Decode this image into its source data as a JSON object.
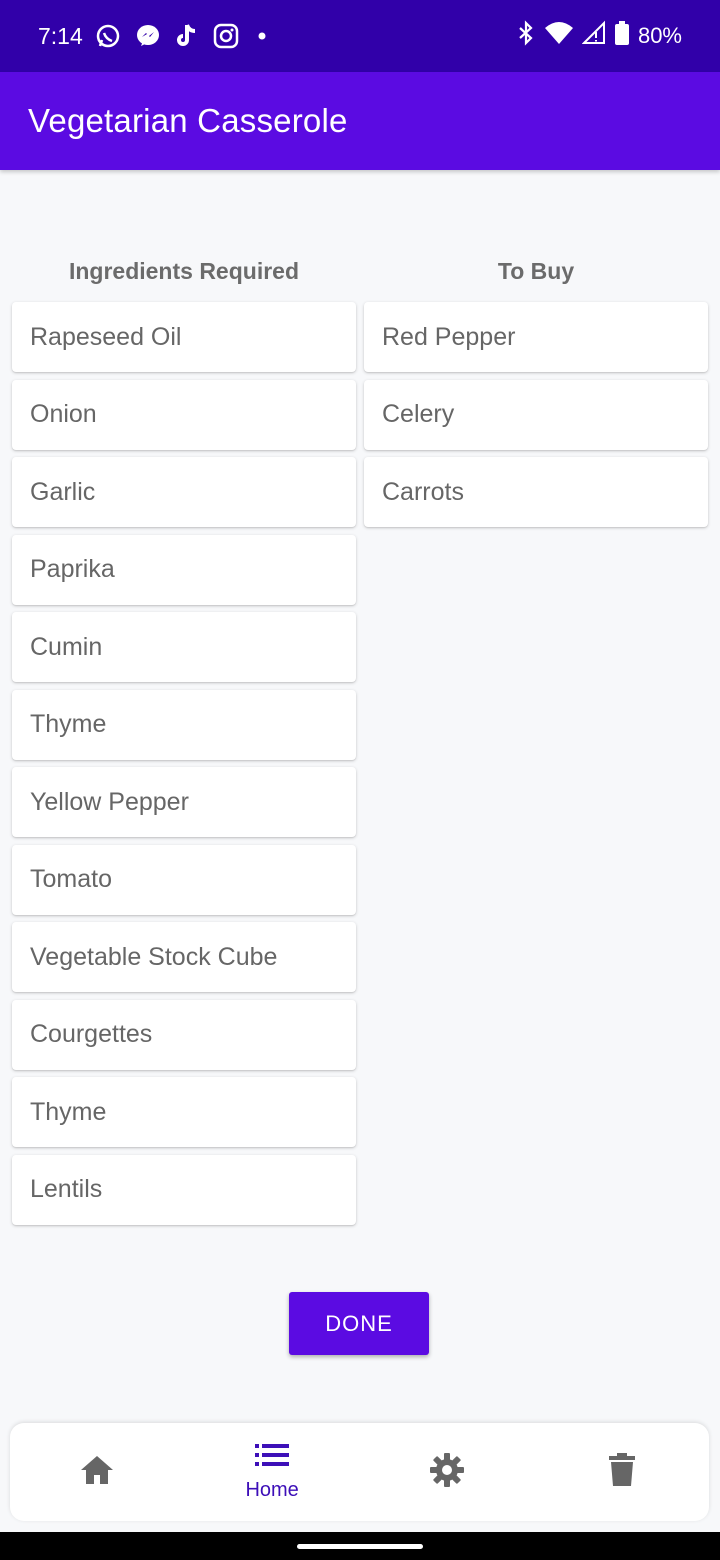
{
  "status_bar": {
    "time": "7:14",
    "battery": "80%",
    "icons": [
      "whatsapp-icon",
      "messenger-icon",
      "tiktok-icon",
      "instagram-icon",
      "dot-icon",
      "bluetooth-icon",
      "wifi-icon",
      "signal-icon",
      "battery-icon"
    ]
  },
  "app_bar": {
    "title": "Vegetarian Casserole"
  },
  "columns": {
    "required_header": "Ingredients Required",
    "to_buy_header": "To Buy"
  },
  "required": [
    "Rapeseed Oil",
    "Onion",
    "Garlic",
    "Paprika",
    "Cumin",
    "Thyme",
    "Yellow Pepper",
    "Tomato",
    "Vegetable Stock Cube",
    "Courgettes",
    "Thyme",
    "Lentils"
  ],
  "to_buy": [
    "Red Pepper",
    "Celery",
    "Carrots"
  ],
  "done_label": "DONE",
  "bottom_nav": {
    "items": [
      {
        "icon": "home-icon",
        "label": ""
      },
      {
        "icon": "list-icon",
        "label": "Home"
      },
      {
        "icon": "gear-icon",
        "label": ""
      },
      {
        "icon": "trash-icon",
        "label": ""
      }
    ]
  },
  "colors": {
    "status_bar": "#3100a9",
    "app_bar": "#5b0be2",
    "accent": "#3d0fb8",
    "background": "#f7f8fa"
  }
}
